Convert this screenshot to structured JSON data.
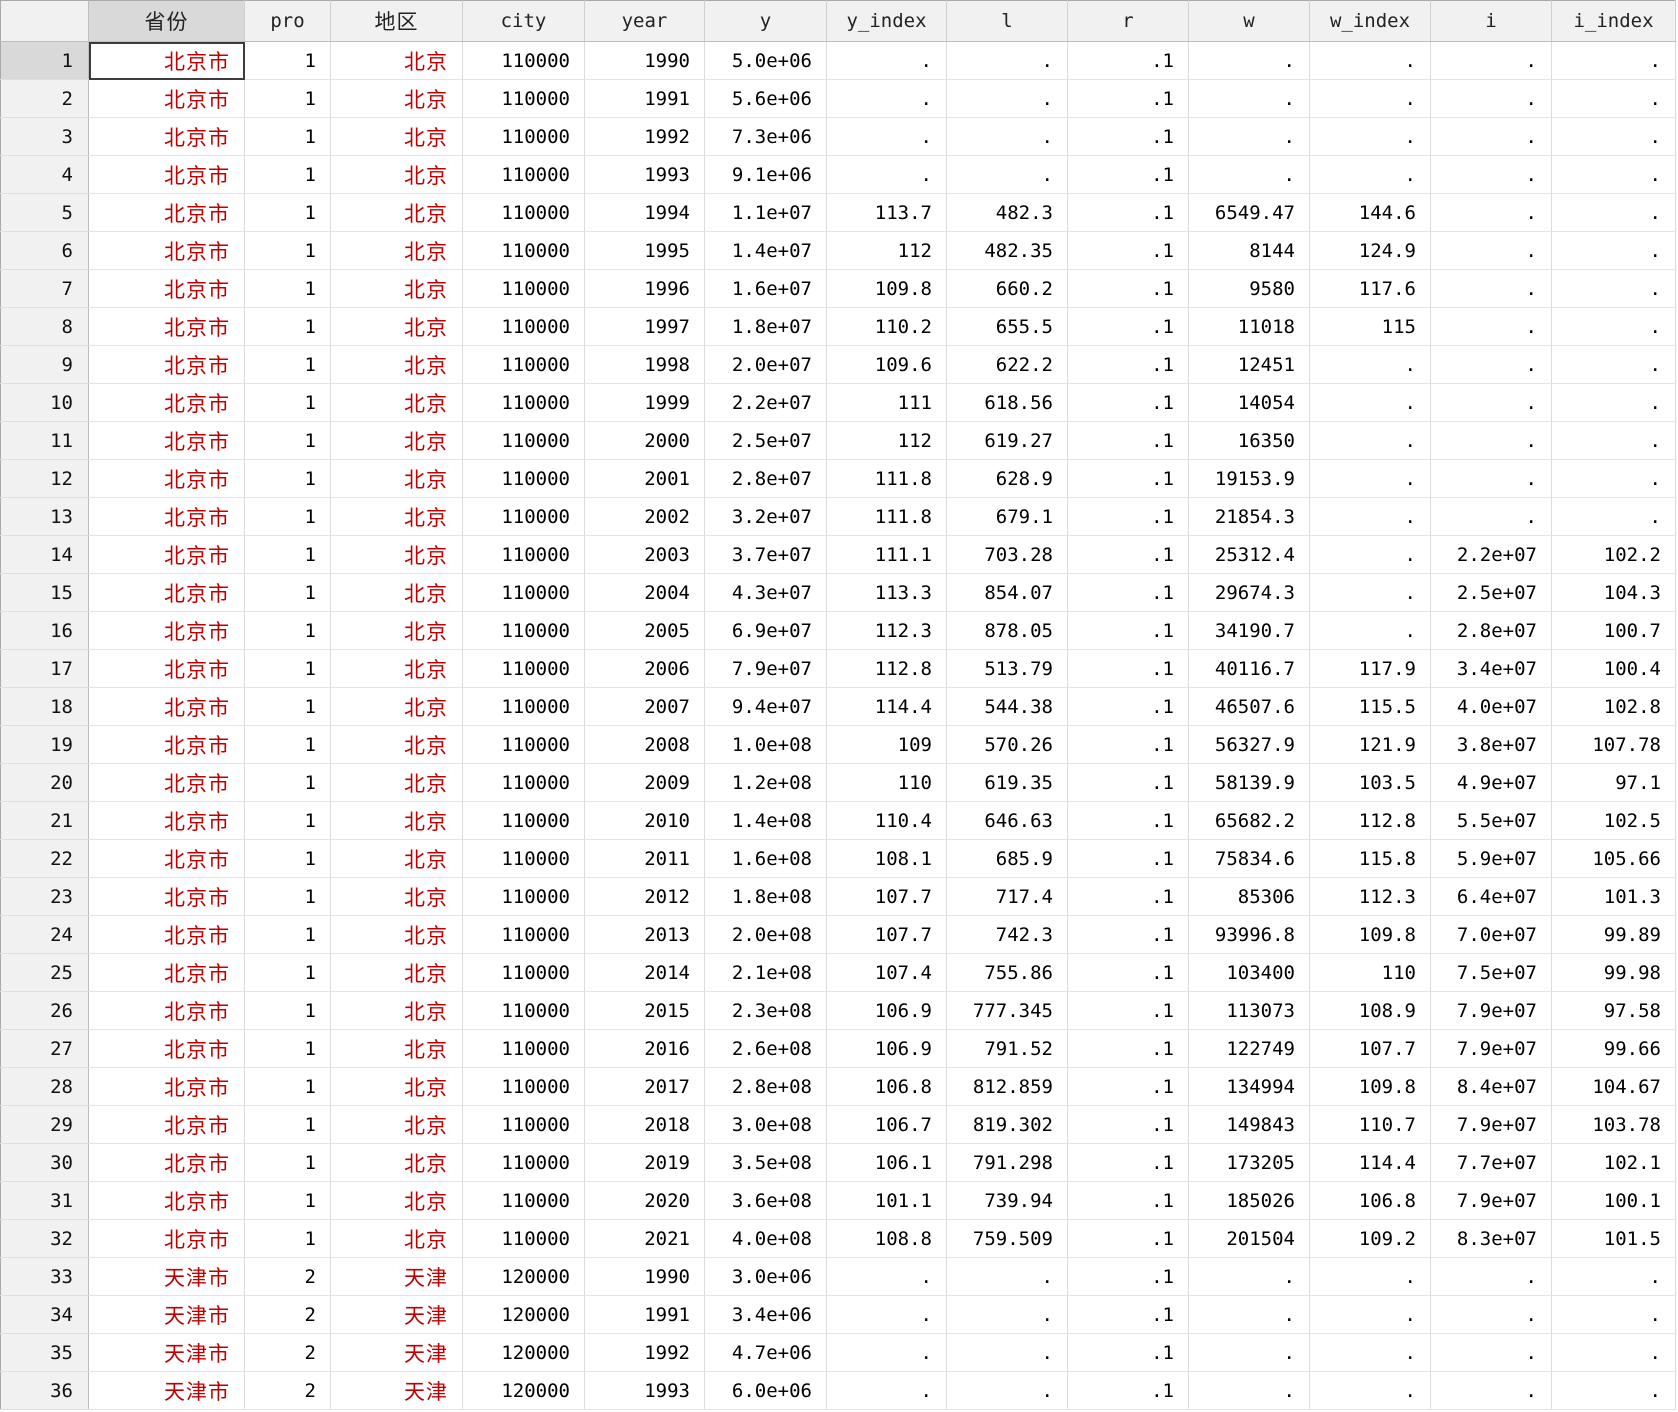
{
  "colors": {
    "string_text": "#c00000"
  },
  "columns": [
    "省份",
    "pro",
    "地区",
    "city",
    "year",
    "y",
    "y_index",
    "l",
    "r",
    "w",
    "w_index",
    "i",
    "i_index"
  ],
  "rows": [
    {
      "n": "1",
      "cells": [
        "北京市",
        "1",
        "北京",
        "110000",
        "1990",
        "5.0e+06",
        ".",
        ".",
        ".1",
        ".",
        ".",
        ".",
        "."
      ]
    },
    {
      "n": "2",
      "cells": [
        "北京市",
        "1",
        "北京",
        "110000",
        "1991",
        "5.6e+06",
        ".",
        ".",
        ".1",
        ".",
        ".",
        ".",
        "."
      ]
    },
    {
      "n": "3",
      "cells": [
        "北京市",
        "1",
        "北京",
        "110000",
        "1992",
        "7.3e+06",
        ".",
        ".",
        ".1",
        ".",
        ".",
        ".",
        "."
      ]
    },
    {
      "n": "4",
      "cells": [
        "北京市",
        "1",
        "北京",
        "110000",
        "1993",
        "9.1e+06",
        ".",
        ".",
        ".1",
        ".",
        ".",
        ".",
        "."
      ]
    },
    {
      "n": "5",
      "cells": [
        "北京市",
        "1",
        "北京",
        "110000",
        "1994",
        "1.1e+07",
        "113.7",
        "482.3",
        ".1",
        "6549.47",
        "144.6",
        ".",
        "."
      ]
    },
    {
      "n": "6",
      "cells": [
        "北京市",
        "1",
        "北京",
        "110000",
        "1995",
        "1.4e+07",
        "112",
        "482.35",
        ".1",
        "8144",
        "124.9",
        ".",
        "."
      ]
    },
    {
      "n": "7",
      "cells": [
        "北京市",
        "1",
        "北京",
        "110000",
        "1996",
        "1.6e+07",
        "109.8",
        "660.2",
        ".1",
        "9580",
        "117.6",
        ".",
        "."
      ]
    },
    {
      "n": "8",
      "cells": [
        "北京市",
        "1",
        "北京",
        "110000",
        "1997",
        "1.8e+07",
        "110.2",
        "655.5",
        ".1",
        "11018",
        "115",
        ".",
        "."
      ]
    },
    {
      "n": "9",
      "cells": [
        "北京市",
        "1",
        "北京",
        "110000",
        "1998",
        "2.0e+07",
        "109.6",
        "622.2",
        ".1",
        "12451",
        ".",
        ".",
        "."
      ]
    },
    {
      "n": "10",
      "cells": [
        "北京市",
        "1",
        "北京",
        "110000",
        "1999",
        "2.2e+07",
        "111",
        "618.56",
        ".1",
        "14054",
        ".",
        ".",
        "."
      ]
    },
    {
      "n": "11",
      "cells": [
        "北京市",
        "1",
        "北京",
        "110000",
        "2000",
        "2.5e+07",
        "112",
        "619.27",
        ".1",
        "16350",
        ".",
        ".",
        "."
      ]
    },
    {
      "n": "12",
      "cells": [
        "北京市",
        "1",
        "北京",
        "110000",
        "2001",
        "2.8e+07",
        "111.8",
        "628.9",
        ".1",
        "19153.9",
        ".",
        ".",
        "."
      ]
    },
    {
      "n": "13",
      "cells": [
        "北京市",
        "1",
        "北京",
        "110000",
        "2002",
        "3.2e+07",
        "111.8",
        "679.1",
        ".1",
        "21854.3",
        ".",
        ".",
        "."
      ]
    },
    {
      "n": "14",
      "cells": [
        "北京市",
        "1",
        "北京",
        "110000",
        "2003",
        "3.7e+07",
        "111.1",
        "703.28",
        ".1",
        "25312.4",
        ".",
        "2.2e+07",
        "102.2"
      ]
    },
    {
      "n": "15",
      "cells": [
        "北京市",
        "1",
        "北京",
        "110000",
        "2004",
        "4.3e+07",
        "113.3",
        "854.07",
        ".1",
        "29674.3",
        ".",
        "2.5e+07",
        "104.3"
      ]
    },
    {
      "n": "16",
      "cells": [
        "北京市",
        "1",
        "北京",
        "110000",
        "2005",
        "6.9e+07",
        "112.3",
        "878.05",
        ".1",
        "34190.7",
        ".",
        "2.8e+07",
        "100.7"
      ]
    },
    {
      "n": "17",
      "cells": [
        "北京市",
        "1",
        "北京",
        "110000",
        "2006",
        "7.9e+07",
        "112.8",
        "513.79",
        ".1",
        "40116.7",
        "117.9",
        "3.4e+07",
        "100.4"
      ]
    },
    {
      "n": "18",
      "cells": [
        "北京市",
        "1",
        "北京",
        "110000",
        "2007",
        "9.4e+07",
        "114.4",
        "544.38",
        ".1",
        "46507.6",
        "115.5",
        "4.0e+07",
        "102.8"
      ]
    },
    {
      "n": "19",
      "cells": [
        "北京市",
        "1",
        "北京",
        "110000",
        "2008",
        "1.0e+08",
        "109",
        "570.26",
        ".1",
        "56327.9",
        "121.9",
        "3.8e+07",
        "107.78"
      ]
    },
    {
      "n": "20",
      "cells": [
        "北京市",
        "1",
        "北京",
        "110000",
        "2009",
        "1.2e+08",
        "110",
        "619.35",
        ".1",
        "58139.9",
        "103.5",
        "4.9e+07",
        "97.1"
      ]
    },
    {
      "n": "21",
      "cells": [
        "北京市",
        "1",
        "北京",
        "110000",
        "2010",
        "1.4e+08",
        "110.4",
        "646.63",
        ".1",
        "65682.2",
        "112.8",
        "5.5e+07",
        "102.5"
      ]
    },
    {
      "n": "22",
      "cells": [
        "北京市",
        "1",
        "北京",
        "110000",
        "2011",
        "1.6e+08",
        "108.1",
        "685.9",
        ".1",
        "75834.6",
        "115.8",
        "5.9e+07",
        "105.66"
      ]
    },
    {
      "n": "23",
      "cells": [
        "北京市",
        "1",
        "北京",
        "110000",
        "2012",
        "1.8e+08",
        "107.7",
        "717.4",
        ".1",
        "85306",
        "112.3",
        "6.4e+07",
        "101.3"
      ]
    },
    {
      "n": "24",
      "cells": [
        "北京市",
        "1",
        "北京",
        "110000",
        "2013",
        "2.0e+08",
        "107.7",
        "742.3",
        ".1",
        "93996.8",
        "109.8",
        "7.0e+07",
        "99.89"
      ]
    },
    {
      "n": "25",
      "cells": [
        "北京市",
        "1",
        "北京",
        "110000",
        "2014",
        "2.1e+08",
        "107.4",
        "755.86",
        ".1",
        "103400",
        "110",
        "7.5e+07",
        "99.98"
      ]
    },
    {
      "n": "26",
      "cells": [
        "北京市",
        "1",
        "北京",
        "110000",
        "2015",
        "2.3e+08",
        "106.9",
        "777.345",
        ".1",
        "113073",
        "108.9",
        "7.9e+07",
        "97.58"
      ]
    },
    {
      "n": "27",
      "cells": [
        "北京市",
        "1",
        "北京",
        "110000",
        "2016",
        "2.6e+08",
        "106.9",
        "791.52",
        ".1",
        "122749",
        "107.7",
        "7.9e+07",
        "99.66"
      ]
    },
    {
      "n": "28",
      "cells": [
        "北京市",
        "1",
        "北京",
        "110000",
        "2017",
        "2.8e+08",
        "106.8",
        "812.859",
        ".1",
        "134994",
        "109.8",
        "8.4e+07",
        "104.67"
      ]
    },
    {
      "n": "29",
      "cells": [
        "北京市",
        "1",
        "北京",
        "110000",
        "2018",
        "3.0e+08",
        "106.7",
        "819.302",
        ".1",
        "149843",
        "110.7",
        "7.9e+07",
        "103.78"
      ]
    },
    {
      "n": "30",
      "cells": [
        "北京市",
        "1",
        "北京",
        "110000",
        "2019",
        "3.5e+08",
        "106.1",
        "791.298",
        ".1",
        "173205",
        "114.4",
        "7.7e+07",
        "102.1"
      ]
    },
    {
      "n": "31",
      "cells": [
        "北京市",
        "1",
        "北京",
        "110000",
        "2020",
        "3.6e+08",
        "101.1",
        "739.94",
        ".1",
        "185026",
        "106.8",
        "7.9e+07",
        "100.1"
      ]
    },
    {
      "n": "32",
      "cells": [
        "北京市",
        "1",
        "北京",
        "110000",
        "2021",
        "4.0e+08",
        "108.8",
        "759.509",
        ".1",
        "201504",
        "109.2",
        "8.3e+07",
        "101.5"
      ]
    },
    {
      "n": "33",
      "cells": [
        "天津市",
        "2",
        "天津",
        "120000",
        "1990",
        "3.0e+06",
        ".",
        ".",
        ".1",
        ".",
        ".",
        ".",
        "."
      ]
    },
    {
      "n": "34",
      "cells": [
        "天津市",
        "2",
        "天津",
        "120000",
        "1991",
        "3.4e+06",
        ".",
        ".",
        ".1",
        ".",
        ".",
        ".",
        "."
      ]
    },
    {
      "n": "35",
      "cells": [
        "天津市",
        "2",
        "天津",
        "120000",
        "1992",
        "4.7e+06",
        ".",
        ".",
        ".1",
        ".",
        ".",
        ".",
        "."
      ]
    },
    {
      "n": "36",
      "cells": [
        "天津市",
        "2",
        "天津",
        "120000",
        "1993",
        "6.0e+06",
        ".",
        ".",
        ".1",
        ".",
        ".",
        ".",
        "."
      ]
    }
  ]
}
